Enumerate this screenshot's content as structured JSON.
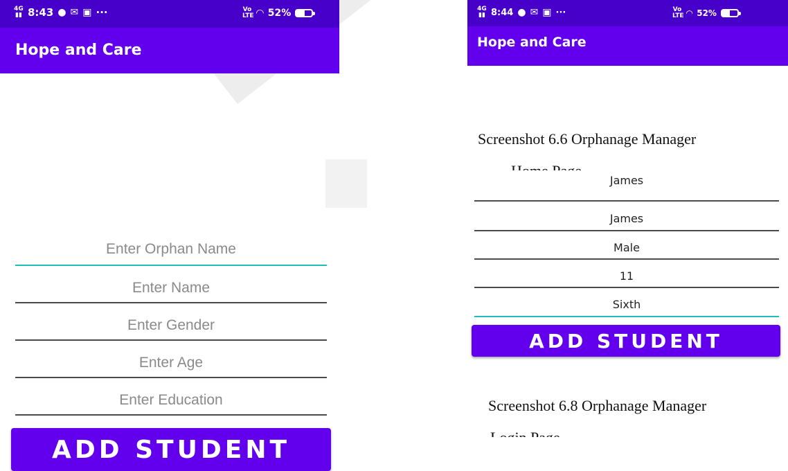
{
  "left_screen": {
    "status_bar": {
      "network": "4G",
      "time": "8:43",
      "more": "···",
      "lte": "LTE",
      "battery": "52%",
      "battery_level": 0.52
    },
    "app_title": "Hope and Care",
    "fields": [
      {
        "placeholder": "Enter Orphan Name",
        "focused": true
      },
      {
        "placeholder": "Enter Name"
      },
      {
        "placeholder": "Enter Gender"
      },
      {
        "placeholder": "Enter Age"
      },
      {
        "placeholder": "Enter Education"
      }
    ],
    "button_label": "ADD STUDENT"
  },
  "right_screen": {
    "status_bar": {
      "network": "4G",
      "time": "8:44",
      "more": "···",
      "lte": "LTE",
      "battery": "52%",
      "battery_level": 0.52
    },
    "app_title": "Hope and Care",
    "fields": [
      {
        "value": "James"
      },
      {
        "value": "James"
      },
      {
        "value": "Male"
      },
      {
        "value": "11"
      },
      {
        "value": "Sixth",
        "focused": true
      }
    ],
    "button_label": "ADD STUDENT"
  },
  "captions": {
    "caption_1": "Screenshot 6.6 Orphanage Manager",
    "caption_1_cut": "Home Page",
    "caption_2": "Screenshot 6.8 Orphanage Manager",
    "caption_2_cut": "Login Page"
  },
  "colors": {
    "primary": "#6200ee",
    "status_bar": "#4700c9",
    "accent": "#1fbfb8"
  }
}
